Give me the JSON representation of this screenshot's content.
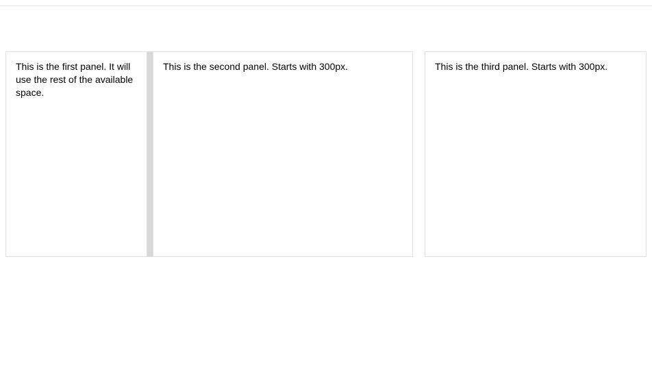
{
  "panels": [
    {
      "text": "This is the first panel. It will use the rest of the available space."
    },
    {
      "text": "This is the second panel. Starts with 300px."
    },
    {
      "text": "This is the third panel. Starts with 300px."
    }
  ]
}
